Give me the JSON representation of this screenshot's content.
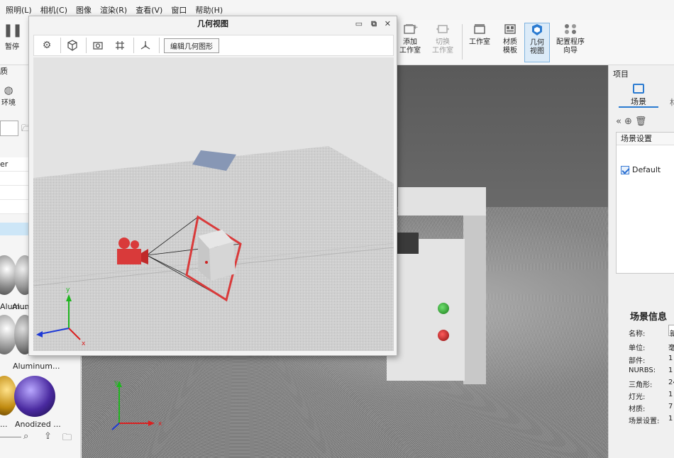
{
  "menu": [
    "照明(L)",
    "相机(C)",
    "图像",
    "渲染(R)",
    "查看(V)",
    "窗口",
    "帮助(H)"
  ],
  "toolbar": {
    "pause_label": "暂停",
    "add_studio": "添加\n工作室",
    "switch_studio": "切换\n工作室",
    "studio": "工作室",
    "material_template": "材质\n模板",
    "geometry_view": "几何\n视图",
    "config_wizard": "配置程序\n向导"
  },
  "left_panel": {
    "header": "质",
    "env_label": "环境",
    "row_er": "er",
    "thumbs": [
      "Alum...",
      "Alum",
      "Aluminum...",
      "...",
      "Anodized ..."
    ]
  },
  "geometry_window": {
    "title": "几何视图",
    "edit_button": "编辑几何图形"
  },
  "right_panel": {
    "title": "项目",
    "tab_scene": "场景",
    "tab_other": "材",
    "list_header": "场景设置",
    "default_item": "Default",
    "scene_info_title": "场景信息",
    "info": [
      {
        "label": "名称:",
        "value": "新"
      },
      {
        "label": "单位:",
        "value": "毫"
      },
      {
        "label": "部件:",
        "value": "1"
      },
      {
        "label": "NURBS:",
        "value": "1"
      },
      {
        "label": "三角形:",
        "value": "24"
      },
      {
        "label": "灯光:",
        "value": "1"
      },
      {
        "label": "材质:",
        "value": "7"
      },
      {
        "label": "场景设置:",
        "value": "1"
      }
    ]
  },
  "colors": {
    "accent": "#2b7bd1",
    "camera_red": "#d93a3a",
    "axis_x": "#d92020",
    "axis_y": "#1fb51f",
    "axis_z": "#1e3ad6"
  }
}
